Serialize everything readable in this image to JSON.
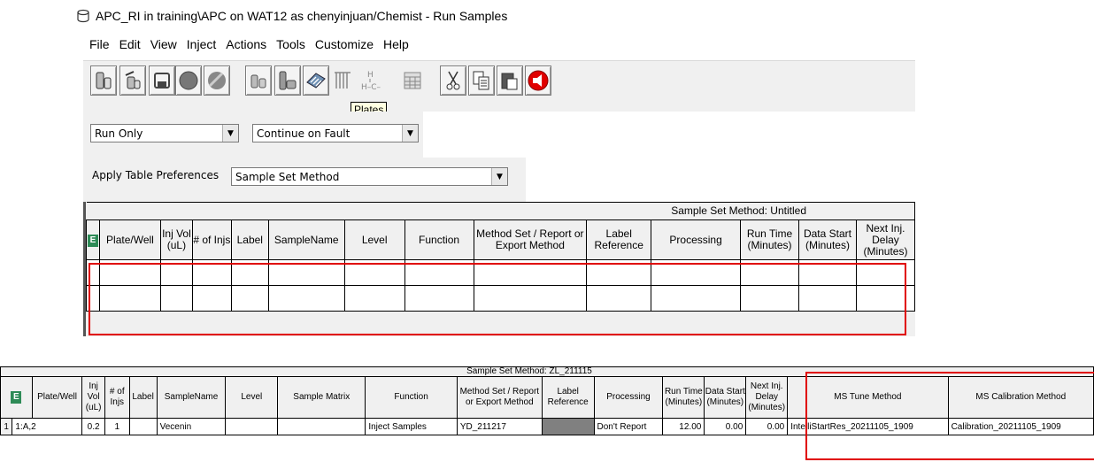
{
  "window": {
    "title": "APC_RI in training\\APC on WAT12 as chenyinjuan/Chemist - Run Samples"
  },
  "menu": [
    "File",
    "Edit",
    "View",
    "Inject",
    "Actions",
    "Tools",
    "Customize",
    "Help"
  ],
  "toolbar": {
    "icons": [
      "vial-icon",
      "edit-vial-icon",
      "save-icon",
      "circle-icon",
      "circle-half-icon",
      "vials-icon",
      "vial-rack-icon",
      "plates-icon",
      "columns-icon",
      "h-c-icon",
      "grid-icon",
      "cut-icon",
      "copy-icon",
      "paste-icon",
      "stop-icon"
    ],
    "tooltip": "Plates"
  },
  "run_mode": {
    "value": "Run Only"
  },
  "fault_mode": {
    "value": "Continue on Fault"
  },
  "preferences": {
    "label": "Apply Table Preferences",
    "value": "Sample Set Method"
  },
  "upper_table": {
    "caption": "Sample Set Method: Untitled",
    "headers": [
      "Plate/Well",
      "Inj Vol (uL)",
      "# of Injs",
      "Label",
      "SampleName",
      "Level",
      "Function",
      "Method Set / Report or Export Method",
      "Label Reference",
      "Processing",
      "Run Time (Minutes)",
      "Data Start (Minutes)",
      "Next Inj. Delay (Minutes)"
    ]
  },
  "lower_table": {
    "caption": "Sample Set Method: ZL_211115",
    "headers": [
      "Plate/Well",
      "Inj Vol (uL)",
      "# of Injs",
      "Label",
      "SampleName",
      "Level",
      "Sample Matrix",
      "Function",
      "Method Set / Report or Export Method",
      "Label Reference",
      "Processing",
      "Run Time (Minutes)",
      "Data Start (Minutes)",
      "Next Inj. Delay (Minutes)",
      "MS Tune Method",
      "MS Calibration Method"
    ],
    "row": {
      "num": "1",
      "plate_well": "1:A,2",
      "inj_vol": "0.2",
      "num_injs": "1",
      "label": "",
      "sample_name": "Vecenin",
      "level": "",
      "sample_matrix": "",
      "function": "Inject Samples",
      "method_set": "YD_211217",
      "label_reference": "",
      "processing": "Don't Report",
      "run_time": "12.00",
      "data_start": "0.00",
      "next_inj_delay": "0.00",
      "ms_tune": "IntelliStartRes_20211105_1909",
      "ms_calibration": "Calibration_20211105_1909"
    }
  },
  "colors": {
    "highlight": "#e00000",
    "badge": "#2e8b57",
    "greyed_cell": "#808080"
  }
}
